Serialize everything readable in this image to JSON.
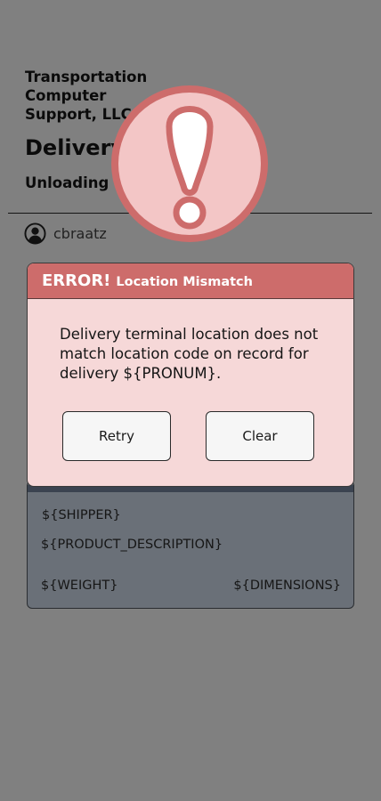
{
  "header": {
    "company_line1": "Transportation",
    "company_line2": "Computer",
    "company_line3": "Support, LLC.",
    "title": "Delivery",
    "subtitle": "Unloading L"
  },
  "user": {
    "name": "cbraatz",
    "icon": "user-avatar-icon"
  },
  "alert_icon": {
    "name": "exclamation-warning-icon",
    "fill": "#f3c6c6",
    "ring": "#cd6c6b"
  },
  "modal": {
    "error_label": "ERROR!",
    "error_title": "Location Mismatch",
    "message": "Delivery terminal location does not match location code on record for delivery ${PRONUM}.",
    "retry_label": "Retry",
    "clear_label": "Clear"
  },
  "shipment_card": {
    "shipper": "${SHIPPER}",
    "product_description": "${PRODUCT_DESCRIPTION}",
    "weight": "${WEIGHT}",
    "dimensions": "${DIMENSIONS}"
  },
  "colors": {
    "background": "#808080",
    "modal_header": "#cd6c6b",
    "modal_body": "#f6d8d8",
    "card": "#6a7078"
  }
}
